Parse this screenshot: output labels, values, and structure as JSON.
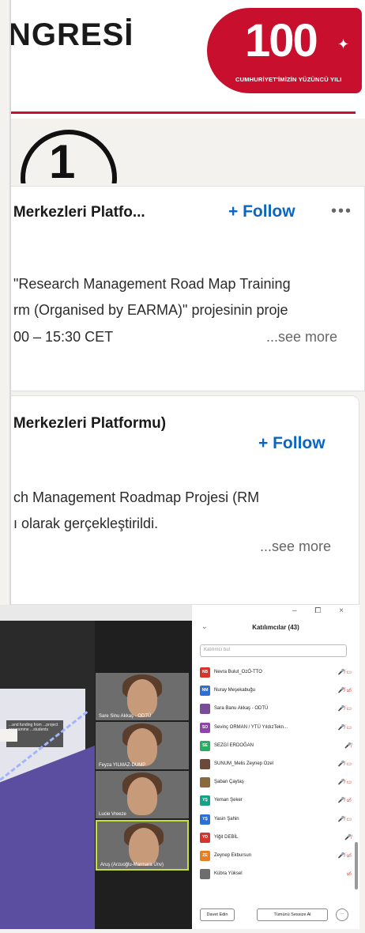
{
  "banner": {
    "title": "NGRESİ",
    "logo_number": "100",
    "logo_subtitle": "CUMHURİYET'İMİZİN YÜZÜNCÜ YILI",
    "accent_color": "#c8102e"
  },
  "annotation": {
    "label": "1"
  },
  "posts": [
    {
      "author": "ji Merkezleri Platfo...",
      "follow_label": "+ Follow",
      "more_label": "•••",
      "lines": [
        "\"Research Management Road Map Training",
        "rm (Organised by EARMA)\" projesinin proje",
        "00 – 15:30 CET"
      ],
      "see_more": "...see more"
    },
    {
      "author": "ji Merkezleri Platformu)",
      "follow_label": "+ Follow",
      "lines": [
        "ch Management Roadmap Projesi (RM",
        "ı olarak gerçekleştirildi."
      ],
      "see_more": "...see more"
    }
  ],
  "zoom": {
    "window_controls": "– ⧠ ×",
    "panel_title": "Katılımcılar (43)",
    "collapse_icon": "chevron-down-icon",
    "search_placeholder": "Katılımcı bul",
    "slide_text": "...and funding from ...project programme ...students",
    "videos": [
      {
        "name": "Sare Sinu Akkaş - ODTÜ",
        "active": false
      },
      {
        "name": "Feyza YILMAZ-DUMP",
        "active": false
      },
      {
        "name": "Lucie Vreeze",
        "active": false
      },
      {
        "name": "Aruş (Arzuoğlu-Marmara Ünv)",
        "active": true
      }
    ],
    "participants": [
      {
        "initials": "NB",
        "name": "Nevra Bulut_OzÖ-TTO",
        "color": "#d8342c",
        "icons": "🎤̸ ▭"
      },
      {
        "initials": "NM",
        "name": "Nuray Meşekabuğu",
        "color": "#2d6fd6",
        "icons": "🎤̸ ▭̸"
      },
      {
        "initials": "",
        "name": "Sara Banu Akkaş - ODTÜ",
        "color": "#7a4b9a",
        "icons": "🎤̸ ▭"
      },
      {
        "initials": "SO",
        "name": "Sevinç ORMAN / YTÜ YıldızTekn...",
        "color": "#8e44ad",
        "icons": "🎤̸ ▭"
      },
      {
        "initials": "SE",
        "name": "SEZGİ ERDOĞAN",
        "color": "#27ae60",
        "icons": "🎤̸"
      },
      {
        "initials": "",
        "name": "SUNUM_Melis Zeynep Ozel",
        "color": "#6b4a3a",
        "icons": "🎤̸ ▭"
      },
      {
        "initials": "",
        "name": "Şaban Çaytaş",
        "color": "#8a6a3a",
        "icons": "🎤̸ ▭"
      },
      {
        "initials": "YŞ",
        "name": "Yeman Şeker",
        "color": "#16a085",
        "icons": "🎤̸ ▭̸"
      },
      {
        "initials": "YŞ",
        "name": "Yasin Şahin",
        "color": "#2d6fd6",
        "icons": "🎤̸ ▭"
      },
      {
        "initials": "YD",
        "name": "Yiğit DEBİL",
        "color": "#d8342c",
        "icons": "🎤̸"
      },
      {
        "initials": "ZE",
        "name": "Zeynep Ekbursun",
        "color": "#e67e22",
        "icons": "🎤̸ ▭̸"
      },
      {
        "initials": "",
        "name": "Kübra Yüksel",
        "color": "#6d6d6d",
        "icons": "▭̸"
      }
    ],
    "invite_label": "Davet Edin",
    "mute_all_label": "Tümünü Sessize Al",
    "more_label": "⋯"
  }
}
